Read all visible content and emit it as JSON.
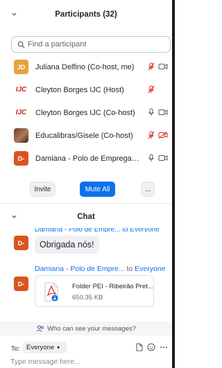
{
  "participants": {
    "title": "Participants (32)",
    "search_placeholder": "Find a participant",
    "list": [
      {
        "avatar": "JD",
        "avatar_color": "#e8a23a",
        "name": "Juliana Delfino (Co-host, me)",
        "mic": "muted",
        "video": "on"
      },
      {
        "avatar": "IJC",
        "name": "Cleyton Borges IJC (Host)",
        "mic": "muted",
        "video": "none"
      },
      {
        "avatar": "IJC",
        "name": "Cleyton Borges IJC (Co-host)",
        "mic": "on",
        "video": "on"
      },
      {
        "avatar": "photo",
        "name": "Educalibras/Gisele (Co-host)",
        "mic": "muted",
        "video": "off"
      },
      {
        "avatar": "D-",
        "avatar_color": "#d9541e",
        "name": "Damiana - Polo de Empregabil...",
        "mic": "on",
        "video": "on"
      }
    ],
    "invite_label": "Invite",
    "mute_all_label": "Mute All",
    "more_label": "..."
  },
  "chat": {
    "title": "Chat",
    "clipped_header": "Damiana - Polo de Empre... to Everyone",
    "messages": [
      {
        "avatar": "D-",
        "text": "Obrigada nós!"
      }
    ],
    "file_message": {
      "avatar": "D-",
      "sender": "Damiana - Polo de Empre...",
      "to_word": "to",
      "recipient": "Everyone",
      "file_name": "Folder PEI - Ribeirão Pret...",
      "file_size": "650.35 KB"
    },
    "who_can_see": "Who can see your messages?",
    "to_label": "To:",
    "to_value": "Everyone",
    "compose_placeholder": "Type message here..."
  },
  "colors": {
    "accent": "#0e71eb",
    "muted_red": "#e02828"
  }
}
